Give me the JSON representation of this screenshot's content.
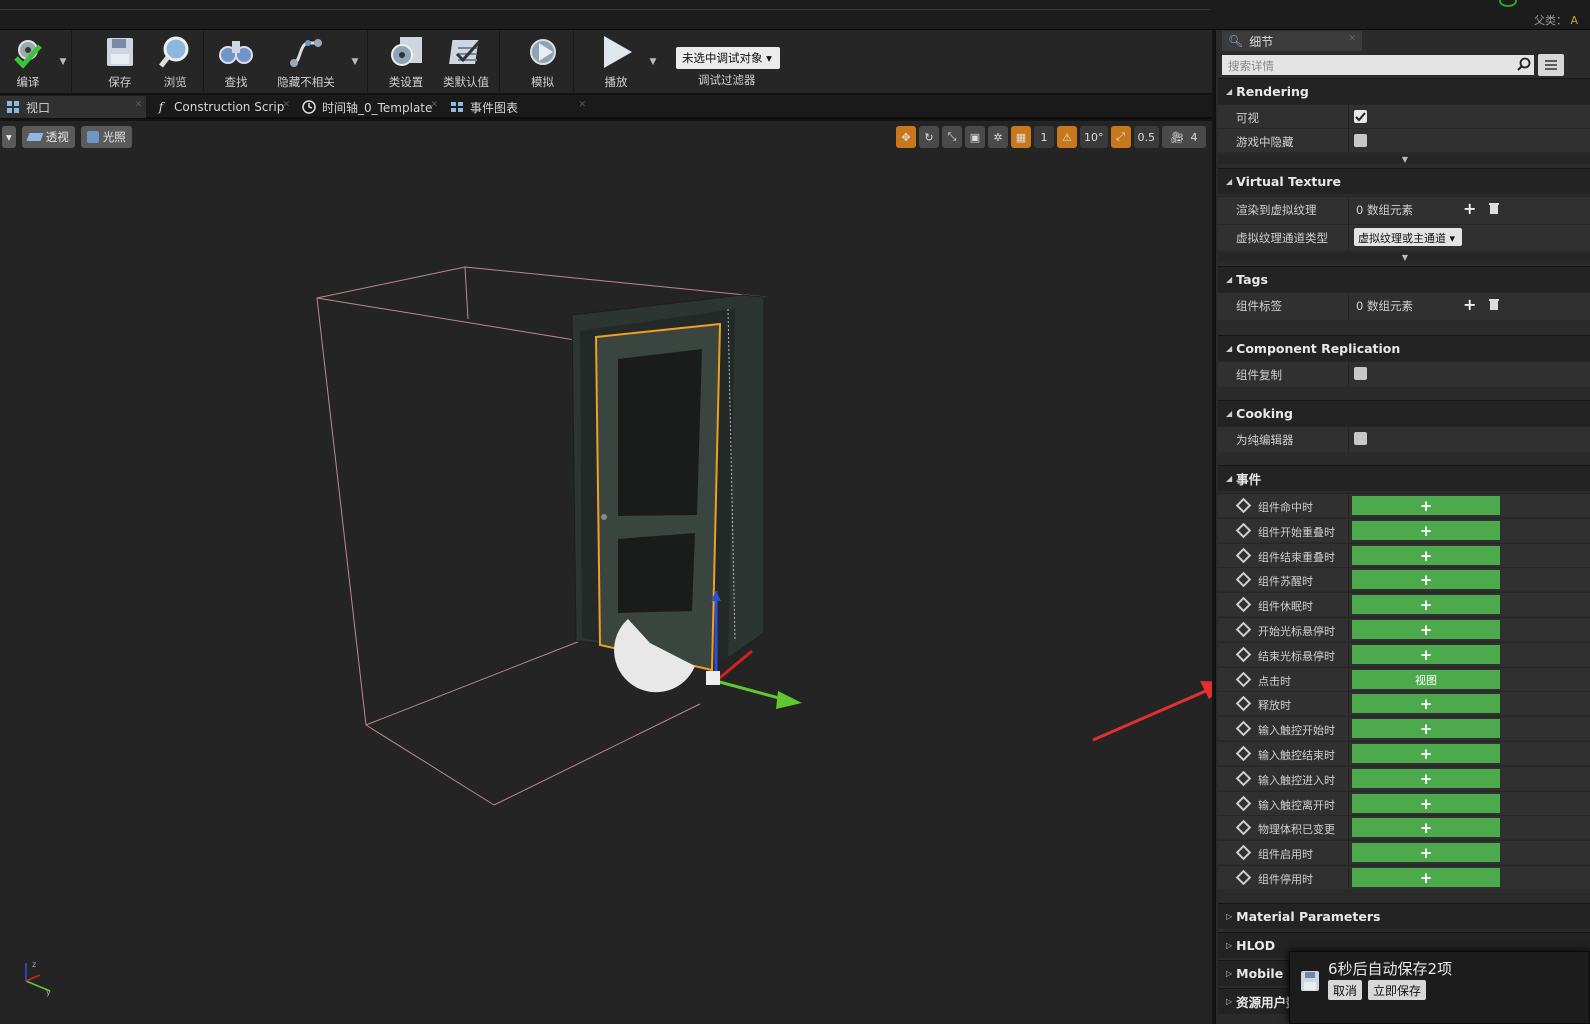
{
  "header": {
    "parent_label": "父类：",
    "parent_value": "A"
  },
  "toolbar": {
    "compile": "编译",
    "save": "保存",
    "browse": "浏览",
    "find": "查找",
    "hide_unrelated": "隐藏不相关",
    "class_settings": "类设置",
    "class_defaults": "类默认值",
    "simulate": "模拟",
    "play": "播放",
    "debug_object": "未选中调试对象",
    "debug_filter": "调试过滤器"
  },
  "tabs": [
    {
      "label": "视口"
    },
    {
      "label": "Construction Scrip"
    },
    {
      "label": "时间轴_0_Template"
    },
    {
      "label": "事件图表"
    }
  ],
  "viewport": {
    "perspective": "透视",
    "lit": "光照",
    "grid_snap": "1",
    "rot_snap": "10°",
    "scale_snap": "0.5",
    "cam_speed": "4"
  },
  "details": {
    "tab_label": "细节",
    "search_placeholder": "搜索详情",
    "sections": {
      "rendering": "Rendering",
      "virtual_texture": "Virtual Texture",
      "tags": "Tags",
      "replication": "Component Replication",
      "cooking": "Cooking",
      "events": "事件",
      "material_params": "Material Parameters",
      "hlod": "HLOD",
      "mobile": "Mobile",
      "asset_user": "资源用户数据"
    },
    "props": {
      "visible": "可视",
      "hidden_in_game": "游戏中隐藏",
      "render_to_vt": "渲染到虚拟纹理",
      "render_to_vt_value": "0 数组元素",
      "vt_pass_type": "虚拟纹理通道类型",
      "vt_pass_value": "虚拟纹理或主通道",
      "component_tags": "组件标签",
      "component_tags_value": "0 数组元素",
      "component_replicates": "组件复制",
      "editor_only": "为纯编辑器"
    },
    "events": [
      {
        "label": "组件命中时",
        "button": "+"
      },
      {
        "label": "组件开始重叠时",
        "button": "+"
      },
      {
        "label": "组件结束重叠时",
        "button": "+"
      },
      {
        "label": "组件苏醒时",
        "button": "+"
      },
      {
        "label": "组件休眠时",
        "button": "+"
      },
      {
        "label": "开始光标悬停时",
        "button": "+"
      },
      {
        "label": "结束光标悬停时",
        "button": "+"
      },
      {
        "label": "点击时",
        "button": "视图"
      },
      {
        "label": "释放时",
        "button": "+"
      },
      {
        "label": "输入触控开始时",
        "button": "+"
      },
      {
        "label": "输入触控结束时",
        "button": "+"
      },
      {
        "label": "输入触控进入时",
        "button": "+"
      },
      {
        "label": "输入触控离开时",
        "button": "+"
      },
      {
        "label": "物理体积已变更",
        "button": "+"
      },
      {
        "label": "组件启用时",
        "button": "+"
      },
      {
        "label": "组件停用时",
        "button": "+"
      }
    ]
  },
  "toast": {
    "message": "6秒后自动保存2项",
    "cancel": "取消",
    "save_now": "立即保存"
  },
  "colors": {
    "accent_green": "#4caa4c",
    "selection_orange": "#f0a020",
    "arrow_red": "#e03030"
  }
}
